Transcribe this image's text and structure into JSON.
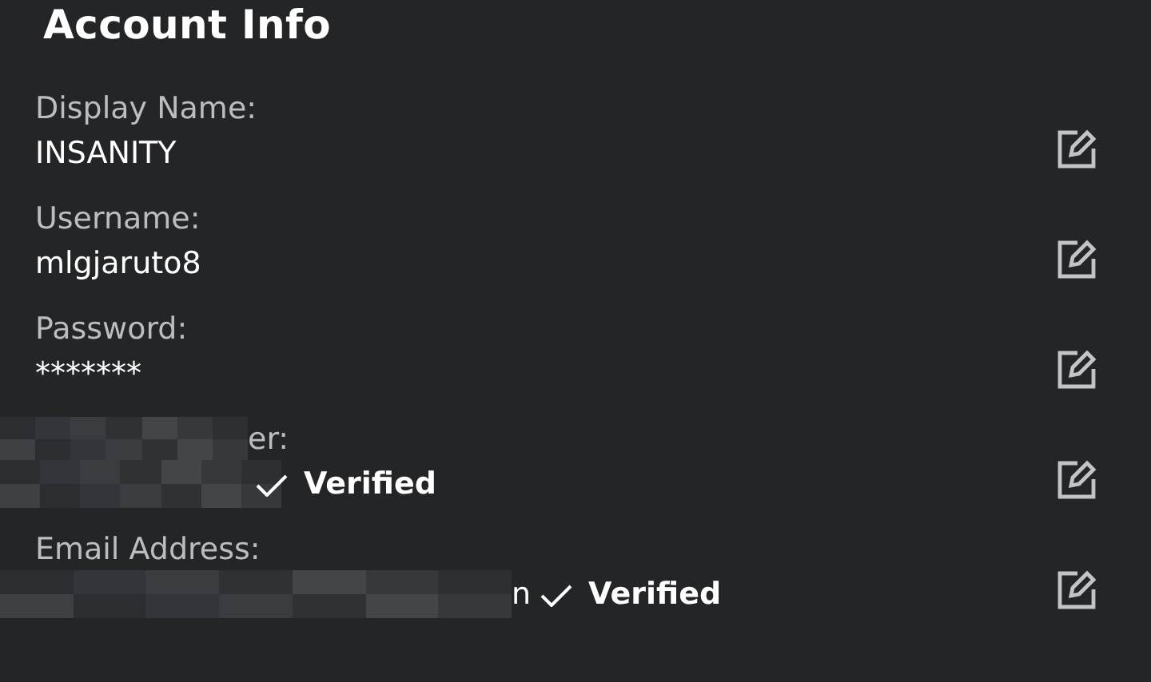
{
  "title": "Account Info",
  "fields": [
    {
      "label": "Display Name:",
      "value": "INSANITY"
    },
    {
      "label": "Username:",
      "value": "mlgjaruto8"
    },
    {
      "label": "Password:",
      "value": "*******"
    },
    {
      "label": "er:",
      "label_redacted": true,
      "value_redacted": true,
      "verified": true,
      "verified_label": "Verified"
    },
    {
      "label": "Email Address:",
      "label_redacted": false,
      "value": "n",
      "value_redacted": true,
      "verified": true,
      "verified_label": "Verified"
    }
  ]
}
